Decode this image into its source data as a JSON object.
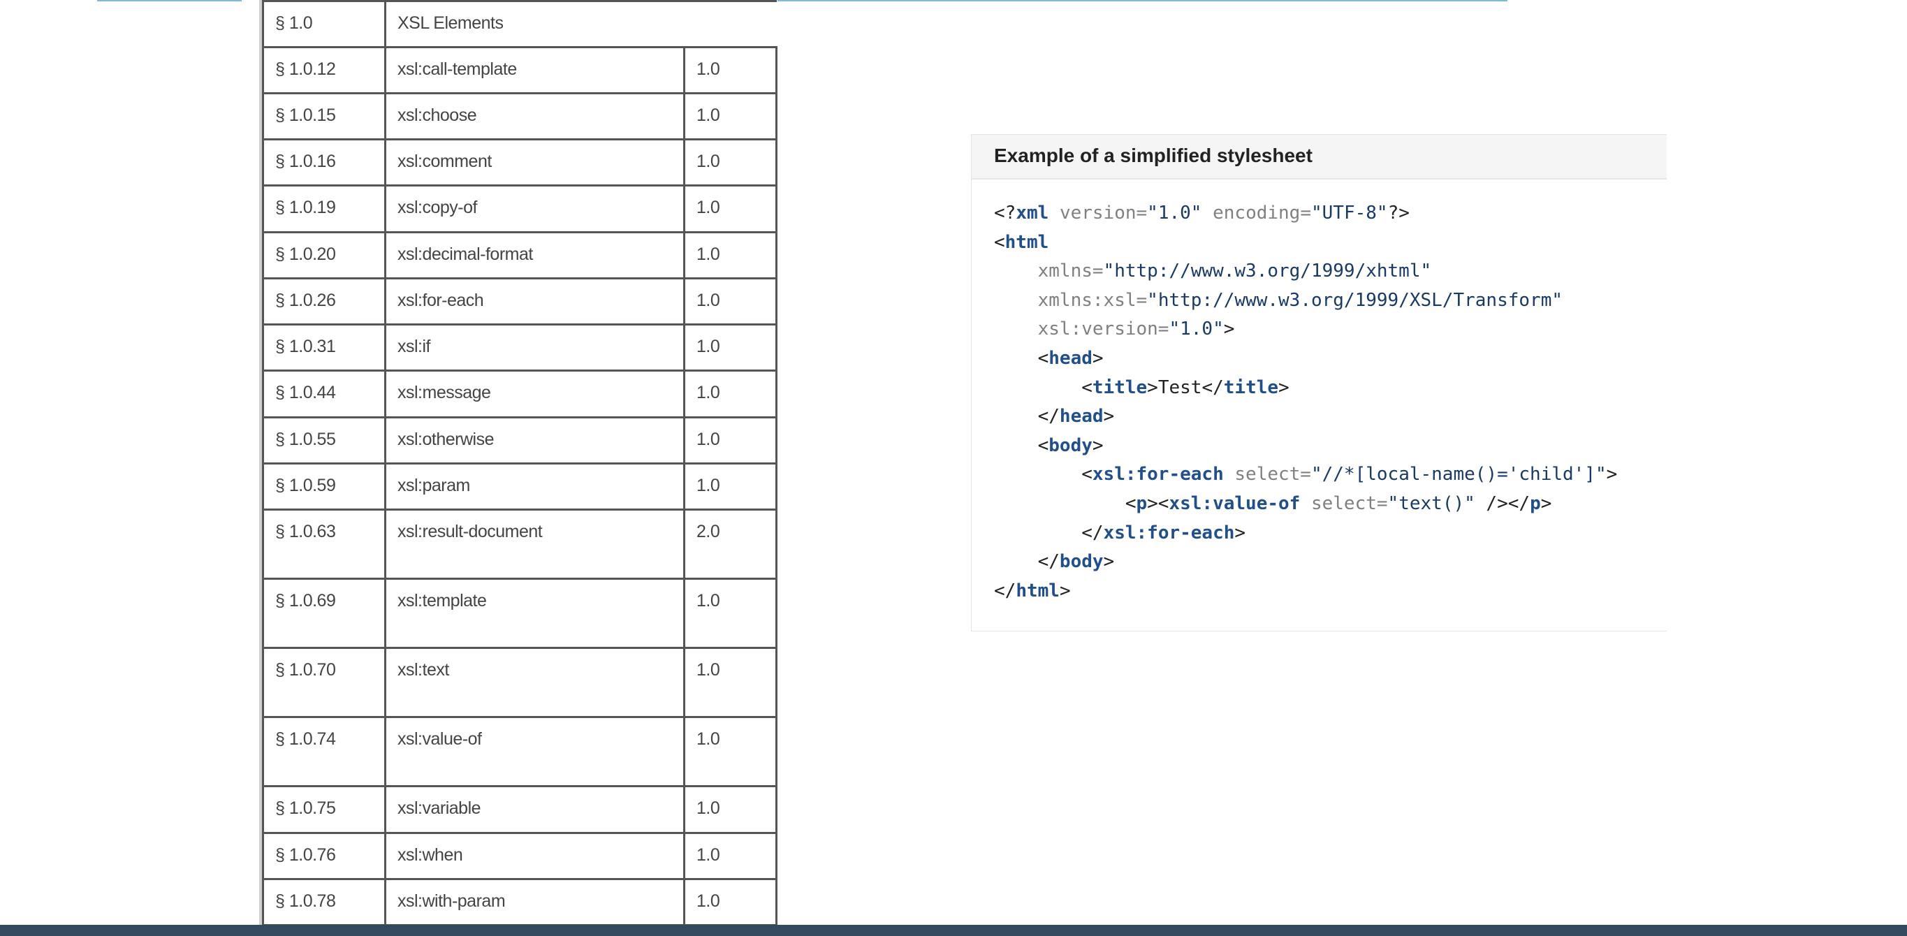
{
  "table": {
    "header": {
      "ref": "§ 1.0",
      "name": "XSL Elements"
    },
    "rows": [
      {
        "ref": "§ 1.0.12",
        "name": "xsl:call-template",
        "version": "1.0"
      },
      {
        "ref": "§ 1.0.15",
        "name": "xsl:choose",
        "version": "1.0"
      },
      {
        "ref": "§ 1.0.16",
        "name": "xsl:comment",
        "version": "1.0"
      },
      {
        "ref": "§ 1.0.19",
        "name": "xsl:copy-of",
        "version": "1.0"
      },
      {
        "ref": "§ 1.0.20",
        "name": "xsl:decimal-format",
        "version": "1.0"
      },
      {
        "ref": "§ 1.0.26",
        "name": "xsl:for-each",
        "version": "1.0"
      },
      {
        "ref": "§ 1.0.31",
        "name": "xsl:if",
        "version": "1.0"
      },
      {
        "ref": "§ 1.0.44",
        "name": "xsl:message",
        "version": "1.0"
      },
      {
        "ref": "§ 1.0.55",
        "name": "xsl:otherwise",
        "version": "1.0"
      },
      {
        "ref": "§ 1.0.59",
        "name": "xsl:param",
        "version": "1.0"
      },
      {
        "ref": "§ 1.0.63",
        "name": "xsl:result-document",
        "version": "2.0"
      },
      {
        "ref": "§ 1.0.69",
        "name": "xsl:template",
        "version": "1.0"
      },
      {
        "ref": "§ 1.0.70",
        "name": "xsl:text",
        "version": "1.0"
      },
      {
        "ref": "§ 1.0.74",
        "name": "xsl:value-of",
        "version": "1.0"
      },
      {
        "ref": "§ 1.0.75",
        "name": "xsl:variable",
        "version": "1.0"
      },
      {
        "ref": "§ 1.0.76",
        "name": "xsl:when",
        "version": "1.0"
      },
      {
        "ref": "§ 1.0.78",
        "name": "xsl:with-param",
        "version": "1.0"
      }
    ]
  },
  "example": {
    "title": "Example of a simplified stylesheet",
    "code": {
      "xml_decl": {
        "open": "<?",
        "tag": "xml",
        "attr1": "version=",
        "val1": "\"1.0\"",
        "attr2": "encoding=",
        "val2": "\"UTF-8\"",
        "close": "?>"
      },
      "html_tag": "html",
      "xmlns_attr": "xmlns=",
      "xmlns_val": "\"http://www.w3.org/1999/xhtml\"",
      "xmlns_xsl_attr": "xmlns:xsl=",
      "xmlns_xsl_val": "\"http://www.w3.org/1999/XSL/Transform\"",
      "version_attr": "xsl:version=",
      "version_val": "\"1.0\"",
      "head_tag": "head",
      "title_tag": "title",
      "title_text": "Test",
      "body_tag": "body",
      "for_each_tag": "xsl:for-each",
      "select_attr": "select=",
      "for_each_select": "\"//*[local-name()='child']\"",
      "p_tag": "p",
      "value_of_tag": "xsl:value-of",
      "value_of_select": "\"text()\""
    }
  },
  "colors": {
    "top_rule": "#7fb8d8",
    "bottom_bar": "#34495e",
    "code_tag": "#214f8a",
    "code_attr": "#808080",
    "code_string": "#1a3a66",
    "table_border": "#555555"
  }
}
